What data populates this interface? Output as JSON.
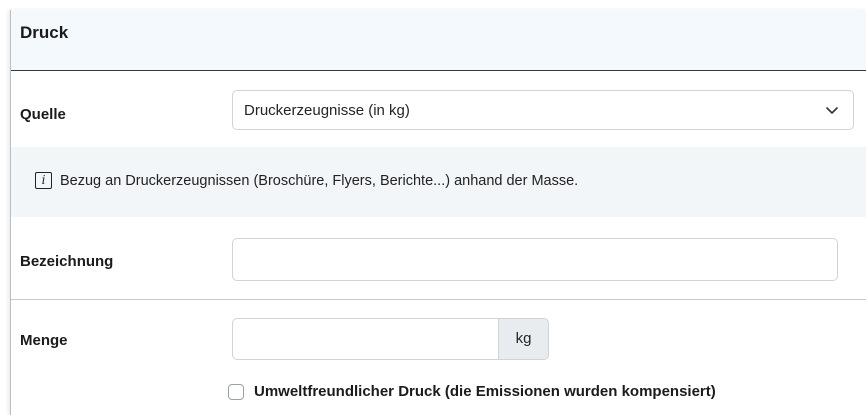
{
  "section": {
    "title": "Druck"
  },
  "source": {
    "label": "Quelle",
    "selected_value": "Druckerzeugnisse (in kg)"
  },
  "info": {
    "icon": "info-icon",
    "icon_glyph": "i",
    "text": "Bezug an Druckerzeugnissen (Broschüre, Flyers, Berichte...) anhand der Masse."
  },
  "designation": {
    "label": "Bezeichnung",
    "value": ""
  },
  "quantity": {
    "label": "Menge",
    "value": "",
    "unit": "kg"
  },
  "eco_print": {
    "label": "Umweltfreundlicher Druck (die Emissionen wurden kompensiert)",
    "checked": false
  },
  "colors": {
    "header_bg": "#f3f9fd",
    "info_bg": "#f3f6f9",
    "input_border": "#ced4da",
    "addon_bg": "#e9ecef"
  }
}
